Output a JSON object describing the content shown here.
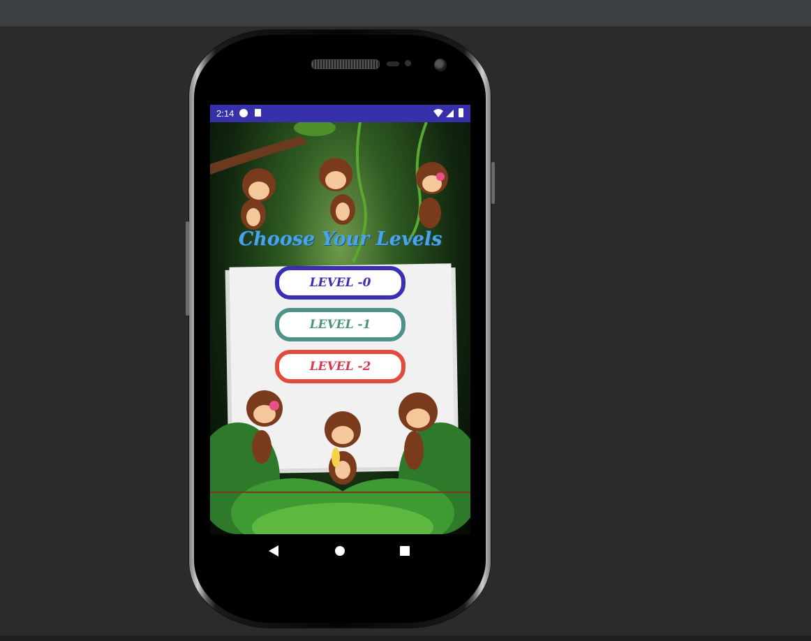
{
  "status_bar": {
    "time": "2:14",
    "icons": [
      "game-notification-icon",
      "sd-card-icon",
      "wifi-icon",
      "signal-icon",
      "battery-icon"
    ]
  },
  "app": {
    "title": "Choose Your Levels",
    "levels": [
      {
        "label": "LEVEL -0",
        "color": "#3a2fb2"
      },
      {
        "label": "LEVEL -1",
        "color": "#4c9286"
      },
      {
        "label": "LEVEL -2",
        "color": "#e24a3c"
      }
    ]
  },
  "nav_bar": {
    "buttons": [
      "back-icon",
      "home-icon",
      "recents-icon"
    ]
  },
  "colors": {
    "status_bar": "#3730ab",
    "title": "#4aa5e6",
    "ide_background": "#2b2b2b"
  }
}
